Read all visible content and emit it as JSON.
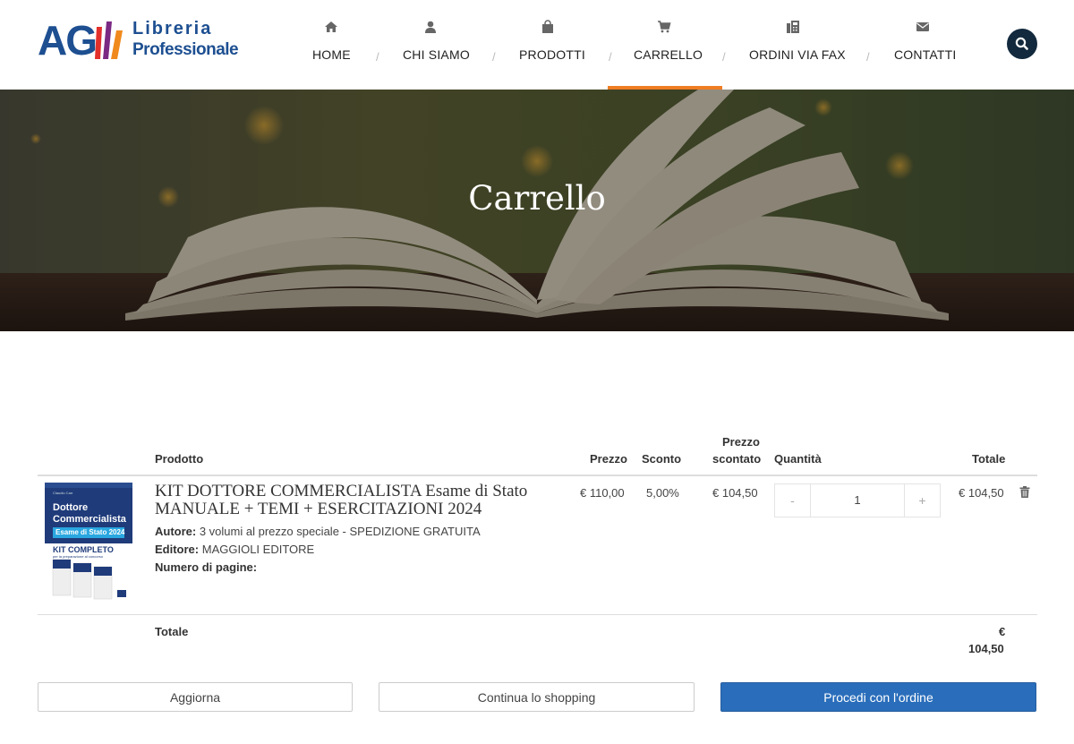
{
  "brand": {
    "logo_main": "AG",
    "logo_line1": "Libreria",
    "logo_line2": "Professionale"
  },
  "nav": {
    "items": [
      {
        "label": "HOME",
        "icon": "home-icon"
      },
      {
        "label": "CHI SIAMO",
        "icon": "user-icon"
      },
      {
        "label": "PRODOTTI",
        "icon": "shopping-bag-icon"
      },
      {
        "label": "CARRELLO",
        "icon": "cart-icon",
        "active": true
      },
      {
        "label": "ORDINI VIA FAX",
        "icon": "fax-icon"
      },
      {
        "label": "CONTATTI",
        "icon": "envelope-icon"
      }
    ],
    "separator": "/",
    "active_color": "#ef7d22"
  },
  "search": {
    "icon": "search-icon"
  },
  "hero": {
    "title": "Carrello"
  },
  "cart": {
    "headers": {
      "product": "Prodotto",
      "price": "Prezzo",
      "discount": "Sconto",
      "discounted_line1": "Prezzo",
      "discounted_line2": "scontato",
      "quantity": "Quantità",
      "total": "Totale"
    },
    "items": [
      {
        "cover": {
          "author": "Claudio Carr",
          "title1": "Dottore",
          "title2": "Commercialista",
          "subtitle": "Esame di Stato 2024",
          "kit": "KIT COMPLETO",
          "kit_sub": "per la preparazione al concorso"
        },
        "title_line1": "KIT DOTTORE COMMERCIALISTA Esame di Stato",
        "title_line2": "MANUALE + TEMI + ESERCITAZIONI 2024",
        "author_label": "Autore:",
        "author_value": "3 volumi al prezzo speciale - SPEDIZIONE GRATUITA",
        "publisher_label": "Editore:",
        "publisher_value": "MAGGIOLI EDITORE",
        "pages_label": "Numero di pagine:",
        "price": "€ 110,00",
        "discount": "5,00%",
        "discounted_price": "€ 104,50",
        "quantity": "1",
        "minus": "-",
        "plus": "+",
        "total": "€ 104,50"
      }
    ],
    "total_label": "Totale",
    "total_currency": "€",
    "total_value": "104,50"
  },
  "buttons": {
    "update": "Aggiorna",
    "continue": "Continua lo shopping",
    "checkout": "Procedi con l'ordine"
  },
  "colors": {
    "primary": "#2a6ebb",
    "accent": "#ef7d22",
    "navy": "#13293d",
    "brand_blue": "#1d4f91"
  }
}
